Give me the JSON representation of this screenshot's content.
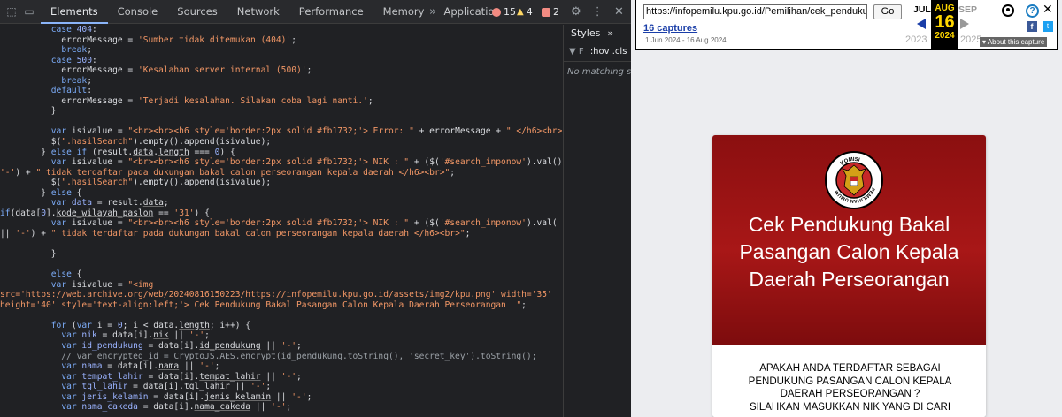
{
  "devtools": {
    "tabs": [
      "Elements",
      "Console",
      "Sources",
      "Network",
      "Performance",
      "Memory",
      "Application"
    ],
    "more": "»",
    "errors": "15",
    "warnings": "4",
    "issues": "2",
    "styles_tab": "Styles",
    "styles_more": "»",
    "filter_text": ":hov .cls",
    "no_match": "No matching selector or style",
    "colors": {
      "error": "#f28b82",
      "warning": "#fdd663",
      "issue": "#f28b82",
      "accent": "#8ab4f8"
    }
  },
  "code_lines": [
    [
      [
        "",
        "          "
      ],
      [
        "k",
        "case"
      ],
      [
        "",
        " "
      ],
      [
        "v",
        "404"
      ],
      [
        "",
        ":"
      ]
    ],
    [
      [
        "",
        "            errorMessage = "
      ],
      [
        "s",
        "'Sumber tidak ditemukan (404)'"
      ],
      [
        "",
        ";"
      ]
    ],
    [
      [
        "",
        "            "
      ],
      [
        "k",
        "break"
      ],
      [
        "",
        ";"
      ]
    ],
    [
      [
        "",
        "          "
      ],
      [
        "k",
        "case"
      ],
      [
        "",
        " "
      ],
      [
        "v",
        "500"
      ],
      [
        "",
        ":"
      ]
    ],
    [
      [
        "",
        "            errorMessage = "
      ],
      [
        "s",
        "'Kesalahan server internal (500)'"
      ],
      [
        "",
        ";"
      ]
    ],
    [
      [
        "",
        "            "
      ],
      [
        "k",
        "break"
      ],
      [
        "",
        ";"
      ]
    ],
    [
      [
        "",
        "          "
      ],
      [
        "k",
        "default"
      ],
      [
        "",
        ":"
      ]
    ],
    [
      [
        "",
        "            errorMessage = "
      ],
      [
        "s",
        "'Terjadi kesalahan. Silakan coba lagi nanti.'"
      ],
      [
        "",
        ";"
      ]
    ],
    [
      [
        "",
        "          }"
      ]
    ],
    [
      [
        "",
        ""
      ]
    ],
    [
      [
        "",
        "          "
      ],
      [
        "k",
        "var"
      ],
      [
        "",
        " isivalue = "
      ],
      [
        "s",
        "\"<br><br><h6 style='border:2px solid #fb1732;'> Error: \""
      ],
      [
        "",
        " + errorMessage + "
      ],
      [
        "s",
        "\" </h6><br>\""
      ]
    ],
    [
      [
        "",
        "          $("
      ],
      [
        "s",
        "\".hasilSearch\""
      ],
      [
        "",
        ").empty().append(isivalue);"
      ]
    ],
    [
      [
        "",
        "        } "
      ],
      [
        "k",
        "else if"
      ],
      [
        "",
        " (result."
      ],
      [
        "u",
        "data"
      ],
      [
        "",
        "."
      ],
      [
        "u",
        "length"
      ],
      [
        "",
        " === "
      ],
      [
        "v",
        "0"
      ],
      [
        "",
        ") {"
      ]
    ],
    [
      [
        "",
        "          "
      ],
      [
        "k",
        "var"
      ],
      [
        "",
        " isivalue = "
      ],
      [
        "s",
        "\"<br><br><h6 style='border:2px solid #fb1732;'> NIK : \""
      ],
      [
        "",
        " + ($("
      ],
      [
        "s",
        "'#search_inponow'"
      ],
      [
        "",
        ").val()"
      ]
    ],
    [
      [
        "s",
        "'-'"
      ],
      [
        "",
        ") + "
      ],
      [
        "s",
        "\" tidak terdaftar pada dukungan bakal calon perseorangan kepala daerah </h6><br>\""
      ],
      [
        "",
        ";"
      ]
    ],
    [
      [
        "",
        "          $("
      ],
      [
        "s",
        "\".hasilSearch\""
      ],
      [
        "",
        ").empty().append(isivalue);"
      ]
    ],
    [
      [
        "",
        "        } "
      ],
      [
        "k",
        "else"
      ],
      [
        "",
        " {"
      ]
    ],
    [
      [
        "",
        "          "
      ],
      [
        "k",
        "var"
      ],
      [
        "",
        " "
      ],
      [
        "v",
        "data"
      ],
      [
        "",
        " = result."
      ],
      [
        "u",
        "data"
      ],
      [
        "",
        ";"
      ]
    ],
    [
      [
        "k",
        "if"
      ],
      [
        "",
        "(data["
      ],
      [
        "v",
        "0"
      ],
      [
        "",
        "]."
      ],
      [
        "u",
        "kode_wilayah_paslon"
      ],
      [
        "",
        " == "
      ],
      [
        "s",
        "'31'"
      ],
      [
        "",
        ") {"
      ]
    ],
    [
      [
        "",
        "          "
      ],
      [
        "k",
        "var"
      ],
      [
        "",
        " isivalue = "
      ],
      [
        "s",
        "\"<br><br><h6 style='border:2px solid #fb1732;'> NIK : \""
      ],
      [
        "",
        " + ($("
      ],
      [
        "s",
        "'#search_inponow'"
      ],
      [
        "",
        ").val("
      ]
    ],
    [
      [
        "",
        "|| "
      ],
      [
        "s",
        "'-'"
      ],
      [
        "",
        ") + "
      ],
      [
        "s",
        "\" tidak terdaftar pada dukungan bakal calon perseorangan kepala daerah </h6><br>\""
      ],
      [
        "",
        ";"
      ]
    ],
    [
      [
        "",
        ""
      ]
    ],
    [
      [
        "",
        "          }"
      ]
    ],
    [
      [
        "",
        ""
      ]
    ],
    [
      [
        "",
        "          "
      ],
      [
        "k",
        "else"
      ],
      [
        "",
        " {"
      ]
    ],
    [
      [
        "",
        "          "
      ],
      [
        "k",
        "var"
      ],
      [
        "",
        " isivalue = "
      ],
      [
        "s",
        "\"<img"
      ]
    ],
    [
      [
        "s",
        "src='https://web.archive.org/web/20240816150223/https://infopemilu.kpu.go.id/assets/img2/kpu.png' width='35'"
      ]
    ],
    [
      [
        "s",
        "height='40' style='text-align:left;'> Cek Pendukung Bakal Pasangan Calon Kepala Daerah Perseorangan  \""
      ],
      [
        "",
        ";"
      ]
    ],
    [
      [
        "",
        ""
      ]
    ],
    [
      [
        "",
        "          "
      ],
      [
        "k",
        "for"
      ],
      [
        "",
        " ("
      ],
      [
        "k",
        "var"
      ],
      [
        "",
        " i = "
      ],
      [
        "v",
        "0"
      ],
      [
        "",
        "; i < data."
      ],
      [
        "u",
        "length"
      ],
      [
        "",
        "; i++) {"
      ]
    ],
    [
      [
        "",
        "            "
      ],
      [
        "k",
        "var"
      ],
      [
        "",
        " "
      ],
      [
        "v",
        "nik"
      ],
      [
        "",
        " = data[i]."
      ],
      [
        "u",
        "nik"
      ],
      [
        "",
        " || "
      ],
      [
        "s",
        "'-'"
      ],
      [
        "",
        ";"
      ]
    ],
    [
      [
        "",
        "            "
      ],
      [
        "k",
        "var"
      ],
      [
        "",
        " "
      ],
      [
        "v",
        "id_pendukung"
      ],
      [
        "",
        " = data[i]."
      ],
      [
        "u",
        "id_pendukung"
      ],
      [
        "",
        " || "
      ],
      [
        "s",
        "'-'"
      ],
      [
        "",
        ";"
      ]
    ],
    [
      [
        "c",
        "            // var encrypted_id = CryptoJS.AES.encrypt(id_pendukung.toString(), 'secret_key').toString();"
      ]
    ],
    [
      [
        "",
        "            "
      ],
      [
        "k",
        "var"
      ],
      [
        "",
        " "
      ],
      [
        "v",
        "nama"
      ],
      [
        "",
        " = data[i]."
      ],
      [
        "u",
        "nama"
      ],
      [
        "",
        " || "
      ],
      [
        "s",
        "'-'"
      ],
      [
        "",
        ";"
      ]
    ],
    [
      [
        "",
        "            "
      ],
      [
        "k",
        "var"
      ],
      [
        "",
        " "
      ],
      [
        "v",
        "tempat_lahir"
      ],
      [
        "",
        " = data[i]."
      ],
      [
        "u",
        "tempat_lahir"
      ],
      [
        "",
        " || "
      ],
      [
        "s",
        "'-'"
      ],
      [
        "",
        ";"
      ]
    ],
    [
      [
        "",
        "            "
      ],
      [
        "k",
        "var"
      ],
      [
        "",
        " "
      ],
      [
        "v",
        "tgl_lahir"
      ],
      [
        "",
        " = data[i]."
      ],
      [
        "u",
        "tgl_lahir"
      ],
      [
        "",
        " || "
      ],
      [
        "s",
        "'-'"
      ],
      [
        "",
        ";"
      ]
    ],
    [
      [
        "",
        "            "
      ],
      [
        "k",
        "var"
      ],
      [
        "",
        " "
      ],
      [
        "v",
        "jenis_kelamin"
      ],
      [
        "",
        " = data[i]."
      ],
      [
        "u",
        "jenis_kelamin"
      ],
      [
        "",
        " || "
      ],
      [
        "s",
        "'-'"
      ],
      [
        "",
        ";"
      ]
    ],
    [
      [
        "",
        "            "
      ],
      [
        "k",
        "var"
      ],
      [
        "",
        " "
      ],
      [
        "v",
        "nama_cakeda"
      ],
      [
        "",
        " = data[i]."
      ],
      [
        "u",
        "nama_cakeda"
      ],
      [
        "",
        " || "
      ],
      [
        "s",
        "'-'"
      ],
      [
        "",
        ";"
      ]
    ]
  ],
  "wayback": {
    "url": "https://infopemilu.kpu.go.id/Pemilihan/cek_pendukung",
    "go": "Go",
    "captures": "16 captures",
    "range": "1 Jun 2024 - 16 Aug 2024",
    "prev_month": "JUL",
    "cur_month": "AUG",
    "next_month": "SEP",
    "day": "16",
    "prev_year": "2023",
    "cur_year": "2024",
    "next_year": "2025",
    "about": "About this capture",
    "help": "?",
    "close": "✕",
    "fb": "f",
    "tw": "t"
  },
  "page": {
    "logo_text": "KOMISI PEMILIHAN UMUM",
    "title": "Cek Pendukung Bakal Pasangan Calon Kepala Daerah Perseorangan",
    "question": "APAKAH ANDA TERDAFTAR SEBAGAI PENDUKUNG PASANGAN CALON KEPALA DAERAH PERSEORANGAN ?",
    "instruction": "SILAHKAN MASUKKAN NIK YANG DI CARI",
    "accent": "#a81717"
  }
}
